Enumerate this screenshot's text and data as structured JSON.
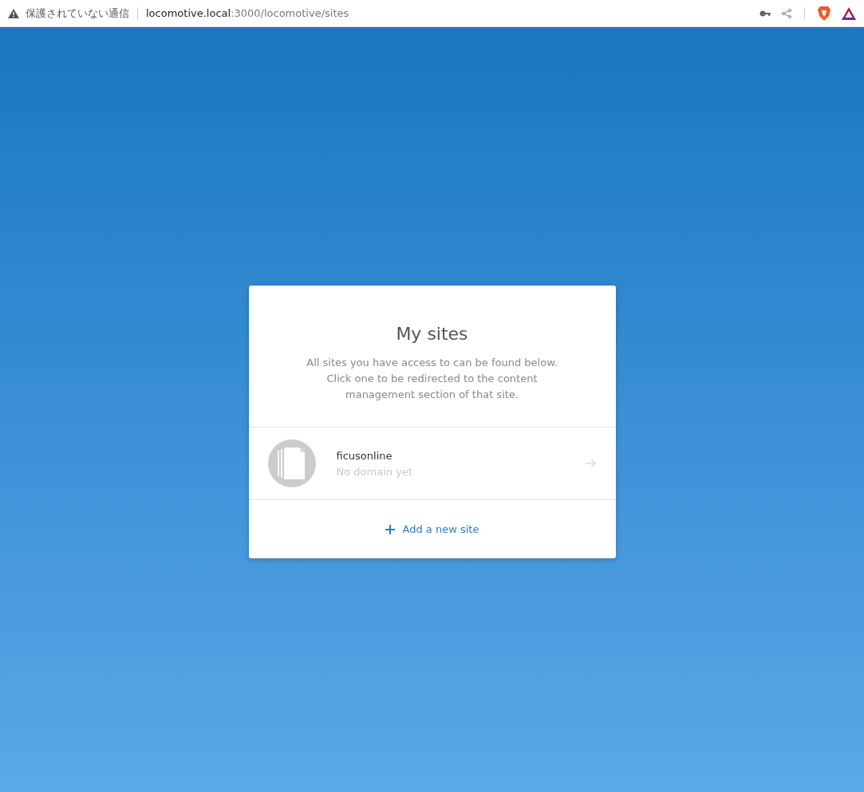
{
  "browser": {
    "security_label": "保護されていない通信",
    "url_host": "locomotive.local",
    "url_path": ":3000/locomotive/sites"
  },
  "card": {
    "title": "My sites",
    "description": "All sites you have access to can be found below. Click one to be redirected to the content management section of that site.",
    "sites": [
      {
        "name": "ficusonline",
        "domain": "No domain yet"
      }
    ],
    "add_label": "Add a new site"
  }
}
